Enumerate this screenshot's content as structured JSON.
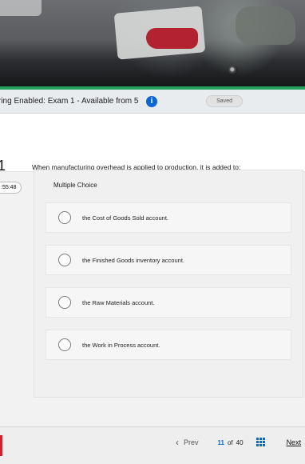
{
  "topbar": {
    "title": "ring Enabled: Exam 1 - Available from 5/...",
    "saved": "Saved"
  },
  "question": {
    "number": "1",
    "text": "When manufacturing overhead is applied to production, it is added to:"
  },
  "timer": ":55:48",
  "choices": {
    "label": "Multiple Choice",
    "options": [
      "the Cost of Goods Sold account.",
      "the Finished Goods inventory account.",
      "the Raw Materials account.",
      "the Work in Process account."
    ]
  },
  "pagination": {
    "prev_label": "Prev",
    "current_page": "11",
    "of_label": "of",
    "total_pages": "40",
    "next_label": "Next"
  }
}
